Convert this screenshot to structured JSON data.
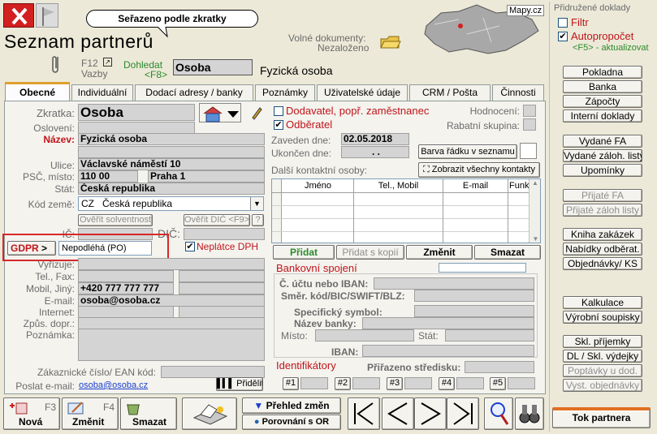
{
  "header": {
    "banner": "Seřazeno podle zkratky",
    "title": "Seznam partnerů",
    "free_docs_label": "Volné dokumenty:",
    "free_docs_value": "Nezaloženo",
    "map_label": "Mapy.cz",
    "f12": "F12",
    "vazby": "Vazby",
    "dohledat": "Dohledat",
    "dohledat_key": "<F8>",
    "search_value": "Osoba",
    "partner_name": "Fyzická osoba"
  },
  "right_panel": {
    "title": "Přidružené doklady",
    "filtr": "Filtr",
    "autoprop": "Autopropočet",
    "f5": "<F5> - aktualizovat",
    "group1": [
      "Pokladna",
      "Banka",
      "Zápočty",
      "Interní doklady"
    ],
    "group2": [
      "Vydané FA",
      "Vydané záloh. listy",
      "Upomínky"
    ],
    "group3": [
      "Přijaté FA",
      "Přijaté záloh listy"
    ],
    "group4": [
      "Kniha zakázek",
      "Nabídky odběrat.",
      "Objednávky/ KS"
    ],
    "group5": [
      "Kalkulace",
      "Výrobní soupisky"
    ],
    "group6": [
      "Skl. příjemky",
      "DL / Skl. výdejky",
      "Poptávky u dod.",
      "Vyst. objednávky"
    ],
    "tok": "Tok partnera"
  },
  "tabs": [
    "Obecné",
    "Individuální",
    "Dodací adresy / banky",
    "Poznámky",
    "Uživatelské údaje",
    "CRM / Pošta",
    "Činnosti"
  ],
  "form": {
    "zkratka_l": "Zkratka:",
    "zkratka": "Osoba",
    "osloveni_l": "Oslovení:",
    "nazev_l": "Název:",
    "nazev": "Fyzická osoba",
    "ulice_l": "Ulice:",
    "ulice": "Václavské náměstí 10",
    "psc_l": "PSČ, místo:",
    "psc": "110 00",
    "misto": "Praha 1",
    "stat_l": "Stát:",
    "stat": "Česká republika",
    "kod_l": "Kód země:",
    "kod": "CZ",
    "kod_name": "Česká republika",
    "overit": "Ověřit solventnost",
    "overit_dic": "Ověřit DIČ <F9>",
    "q": "?",
    "ic_l": "IČ:",
    "dic_l": "DIČ:",
    "gdpr_btn": "GDPR",
    "gdpr_arrow": ">",
    "gdpr_value": "Nepodléhá (PO)",
    "neplatce": "Neplátce DPH",
    "vyrizuje_l": "Vyřizuje:",
    "tel_l": "Tel., Fax:",
    "mobil_l": "Mobil, Jiný:",
    "mobil": "+420 777 777 777",
    "email_l": "E-mail:",
    "email": "osoba@osoba.cz",
    "internet_l": "Internet:",
    "zpus_l": "Způs. dopr.:",
    "poznamka_l": "Poznámka:",
    "ean_l": "Zákaznické číslo/ EAN kód:",
    "poslat_l": "Poslat e-mail:",
    "poslat": "osoba@osoba.cz",
    "pridelit": "Přidělit"
  },
  "mid": {
    "dodavatel": "Dodavatel, popř. zaměstnanec",
    "odberatel": "Odběratel",
    "hodnoceni_l": "Hodnocení:",
    "rabat_l": "Rabatní skupina:",
    "zaveden_l": "Zaveden dne:",
    "zaveden": "02.05.2018",
    "ukoncen_l": "Ukončen dne:",
    "ukoncen": ". .",
    "barva": "Barva řádku v seznamu",
    "dalsi_l": "Další kontaktní osoby:",
    "zobrazit": "Zobrazit všechny kontakty",
    "cols": [
      "Jméno",
      "Tel., Mobil",
      "E-mail",
      "Funk"
    ],
    "pridat": "Přidat",
    "pridat_kopii": "Přidat s kopií",
    "zmenit": "Změnit",
    "smazat": "Smazat",
    "bank_title": "Bankovní spojení",
    "ucet_l": "Č. účtu nebo IBAN:",
    "smer_l": "Směr. kód/BIC/SWIFT/BLZ:",
    "spec_l": "Specifický symbol:",
    "banka_l": "Název banky:",
    "misto_l": "Místo:",
    "stat_l": "Stát:",
    "iban_l": "IBAN:",
    "ident_l": "Identifikátory",
    "stredisko_l": "Přiřazeno středisku:",
    "ids": [
      "#1",
      "#2",
      "#3",
      "#4",
      "#5"
    ]
  },
  "toolbar": {
    "nova": "Nová",
    "nova_key": "F3",
    "zmenit": "Změnit",
    "zmenit_key": "F4",
    "smazat": "Smazat",
    "prehled": "Přehled změn",
    "porovnani": "Porovnání s OR"
  }
}
